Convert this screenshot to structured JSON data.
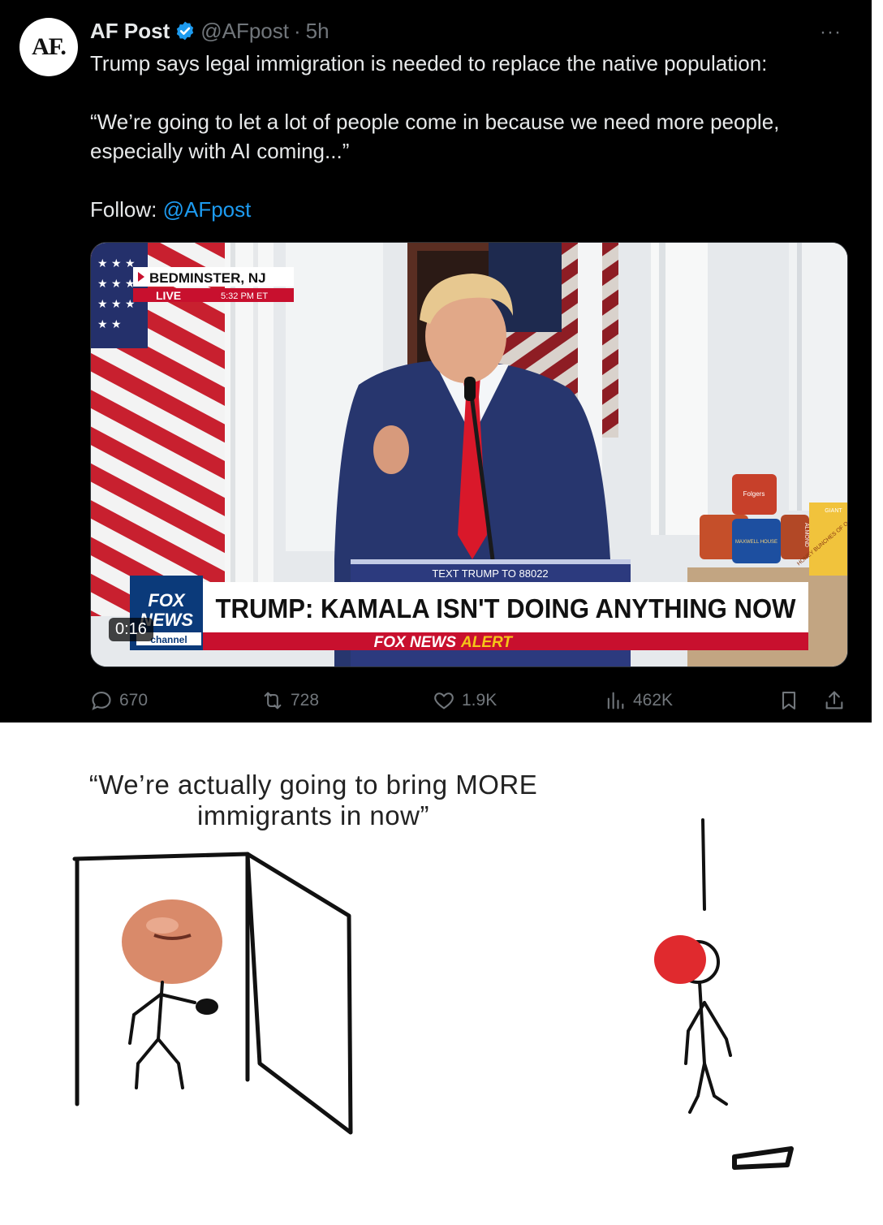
{
  "tweet": {
    "avatar_text": "AF.",
    "author_name": "AF Post",
    "handle": "@AFpost",
    "separator": "·",
    "time": "5h",
    "more_label": "···",
    "text_line1": "Trump says legal immigration is needed to replace the native population:",
    "quote_line1": " “We’re going to let a lot of people come in because we need more people,",
    "quote_line2": "especially with AI coming...”",
    "follow_label": "Follow: ",
    "follow_link": "@AFpost",
    "colors": {
      "background": "#000000",
      "text": "#e7e9ea",
      "muted": "#71767b",
      "link": "#1d9bf0",
      "verified": "#1d9bf0"
    }
  },
  "video": {
    "location": "BEDMINSTER, NJ",
    "live_label": "LIVE",
    "live_time": "5:32 PM ET",
    "podium_text": "TEXT TRUMP TO 88022",
    "channel_logo_top": "FOX",
    "channel_logo_bottom": "NEWS",
    "channel_sub": "channel",
    "headline": "TRUMP: KAMALA ISN'T DOING ANYTHING NOW",
    "alert_brand": "FOX NEWS",
    "alert_word": "ALERT",
    "duration": "0:16",
    "can_labels": [
      "Folgers",
      "MAXWELL HOUSE"
    ],
    "box_labels": [
      "HONEY BUNCHES OF OATS",
      "ALMOND",
      "GIANT"
    ]
  },
  "actions": {
    "replies": "670",
    "reposts": "728",
    "likes": "1.9K",
    "views": "462K",
    "icons": [
      "reply-icon",
      "repost-icon",
      "like-icon",
      "views-icon",
      "bookmark-icon",
      "share-icon"
    ]
  },
  "meme": {
    "caption_line1": "“We’re actually going to bring MORE",
    "caption_line2": "immigrants in now”"
  }
}
